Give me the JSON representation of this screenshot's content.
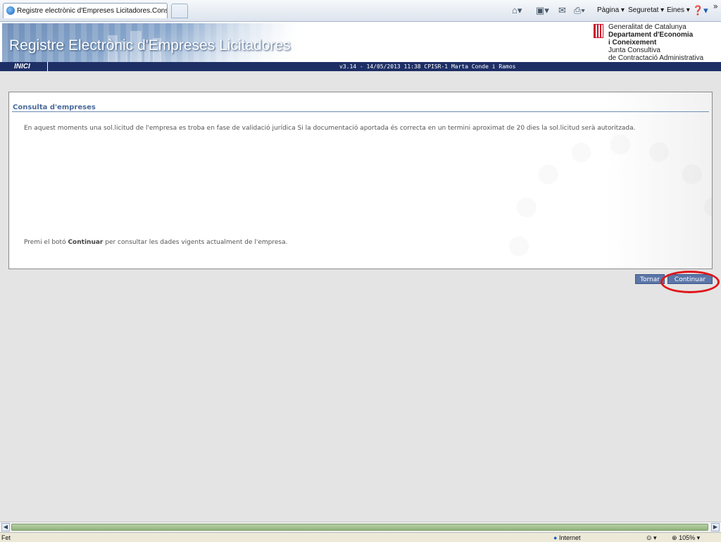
{
  "browser": {
    "tab_title": "Registre electrònic d'Empreses Licitadores.Consulta A...",
    "toolbar": {
      "home_icon": "home-icon",
      "feeds_icon": "rss-icon",
      "mail_icon": "mail-icon",
      "print_icon": "printer-icon",
      "page_menu": "Pàgina",
      "security_menu": "Seguretat",
      "tools_menu": "Eines",
      "help_icon": "help-icon",
      "more": "»"
    },
    "status": {
      "left": "Fet",
      "zone": "Internet",
      "zoom": "105%"
    }
  },
  "header": {
    "site_title": "Registre Electrònic d'Empreses Licitadores",
    "org": {
      "line1": "Generalitat de Catalunya",
      "line2": "Departament d'Economia",
      "line3": "i Coneixement",
      "line4": "Junta Consultiva",
      "line5": "de Contractació Administrativa"
    }
  },
  "nav": {
    "home": "INICI",
    "version_info": "v3.14 - 14/05/2013 11:38 CPISR-1 Marta Conde i Ramos"
  },
  "main": {
    "section_title": "Consulta d'empreses",
    "message": "En aquest moments una sol.licitud de l'empresa es troba en fase de validació jurídica Si la documentació aportada és correcta en un termini aproximat de 20 dies la sol.licitud serà autoritzada.",
    "instruction_prefix": "Premi el botó ",
    "instruction_bold": "Continuar",
    "instruction_suffix": " per consultar les dades vigents actualment de l'empresa."
  },
  "actions": {
    "back": "Tornar",
    "continue": "Continuar"
  },
  "colors": {
    "navbar": "#1e2f66",
    "button": "#5b76a8",
    "highlight": "#e0161b"
  }
}
